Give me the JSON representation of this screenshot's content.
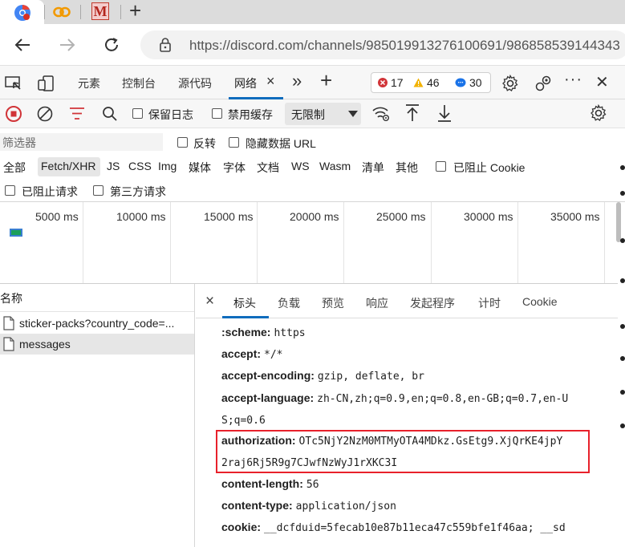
{
  "browser": {
    "url": "https://discord.com/channels/985019913276100691/986858539144343",
    "tabs": [
      {
        "icon": "google-chrome-favicon"
      },
      {
        "icon": "link-favicon"
      },
      {
        "icon": "m-favicon",
        "label": "M"
      }
    ],
    "new_tab": "+"
  },
  "devtools": {
    "tabs": [
      "元素",
      "控制台",
      "源代码",
      "网络"
    ],
    "active_tab": "网络",
    "close_tab": "×",
    "more": "»",
    "add": "+",
    "errors": "17",
    "warnings": "46",
    "messages": "30",
    "more_menu": "···",
    "close": "✕"
  },
  "network_toolbar": {
    "preserve_log": "保留日志",
    "disable_cache": "禁用缓存",
    "throttle": "无限制"
  },
  "filter": {
    "placeholder": "筛选器",
    "invert": "反转",
    "hide_data_url": "隐藏数据 URL"
  },
  "types": [
    "全部",
    "Fetch/XHR",
    "JS",
    "CSS",
    "Img",
    "媒体",
    "字体",
    "文档",
    "WS",
    "Wasm",
    "清单",
    "其他"
  ],
  "blocked_cookies": "已阻止 Cookie",
  "blocked_requests": "已阻止请求",
  "third_party": "第三方请求",
  "timeline": {
    "labels": [
      "5000 ms",
      "10000 ms",
      "15000 ms",
      "20000 ms",
      "25000 ms",
      "30000 ms",
      "35000 ms"
    ]
  },
  "requests": {
    "header": "名称",
    "rows": [
      "sticker-packs?country_code=...",
      "messages"
    ]
  },
  "detail_tabs": [
    "标头",
    "负载",
    "预览",
    "响应",
    "发起程序",
    "计时",
    "Cookie"
  ],
  "detail_close": "×",
  "headers": [
    {
      "k": ":scheme:",
      "v": "https"
    },
    {
      "k": "accept:",
      "v": "*/*"
    },
    {
      "k": "accept-encoding:",
      "v": "gzip, deflate, br"
    },
    {
      "k": "accept-language:",
      "v": "zh-CN,zh;q=0.9,en;q=0.8,en-GB;q=0.7,en-U"
    },
    {
      "k": "",
      "v": "S;q=0.6"
    },
    {
      "k": "authorization:",
      "v": "OTc5NjY2NzM0MTMyOTA4MDkz.GsEtg9.XjQrKE4jpY"
    },
    {
      "k": "",
      "v": "2raj6Rj5R9g7CJwfNzWyJ1rXKC3I"
    },
    {
      "k": "content-length:",
      "v": "56"
    },
    {
      "k": "content-type:",
      "v": "application/json"
    },
    {
      "k": "cookie:",
      "v": "__dcfduid=5fecab10e87b11eca47c559bfe1f46aa; __sd"
    }
  ],
  "colors": {
    "accent": "#0f6cbd",
    "error": "#d13438",
    "warning": "#f2b200",
    "info": "#1a73e8",
    "highlight": "#e8212b",
    "record": "#d13438"
  }
}
